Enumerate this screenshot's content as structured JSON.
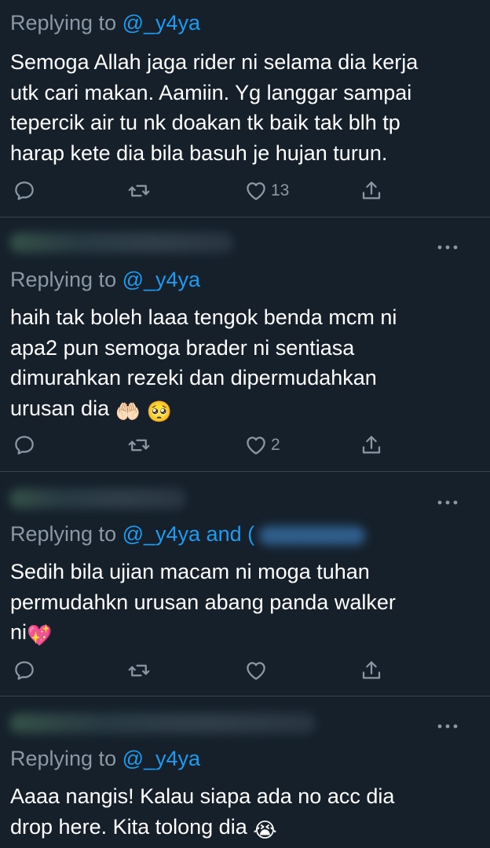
{
  "tweets": [
    {
      "reply_prefix": "Replying to ",
      "reply_handle": "@_y4ya",
      "reply_suffix": "",
      "text_lines": [
        "Semoga Allah jaga rider ni selama dia kerja",
        "utk cari makan. Aamiin. Yg langgar sampai",
        "tepercik air tu nk doakan tk baik tak blh tp",
        "harap kete dia bila basuh je hujan turun."
      ],
      "like_count": "13"
    },
    {
      "reply_prefix": "Replying to ",
      "reply_handle": "@_y4ya",
      "reply_suffix": "",
      "text_lines": [
        "haih tak boleh laaa tengok benda mcm ni",
        "apa2 pun semoga brader ni sentiasa",
        "dimurahkan rezeki dan dipermudahkan",
        "urusan dia"
      ],
      "emojis": [
        "🤲🏻",
        "🥺"
      ],
      "like_count": "2"
    },
    {
      "reply_prefix": "Replying to ",
      "reply_handle": "@_y4ya and (",
      "reply_suffix": "",
      "text_lines": [
        "Sedih bila ujian  macam ni moga tuhan",
        "permudahkn urusan abang panda walker",
        "ni"
      ],
      "emojis": [
        "💖"
      ],
      "like_count": ""
    },
    {
      "reply_prefix": "Replying to ",
      "reply_handle": "@_y4ya",
      "reply_suffix": "",
      "text_lines": [
        "Aaaa nangis! Kalau siapa ada no acc dia",
        "drop here. Kita tolong dia"
      ],
      "emojis": [
        "😭"
      ],
      "like_count": ""
    }
  ],
  "icons": {
    "reply": "reply-icon",
    "retweet": "retweet-icon",
    "like": "heart-icon",
    "share": "share-icon",
    "more": "more-icon"
  },
  "colors": {
    "background": "#15202b",
    "divider": "#38444d",
    "muted_text": "#8b98a5",
    "link": "#1d9bf0",
    "text": "#ffffff"
  }
}
